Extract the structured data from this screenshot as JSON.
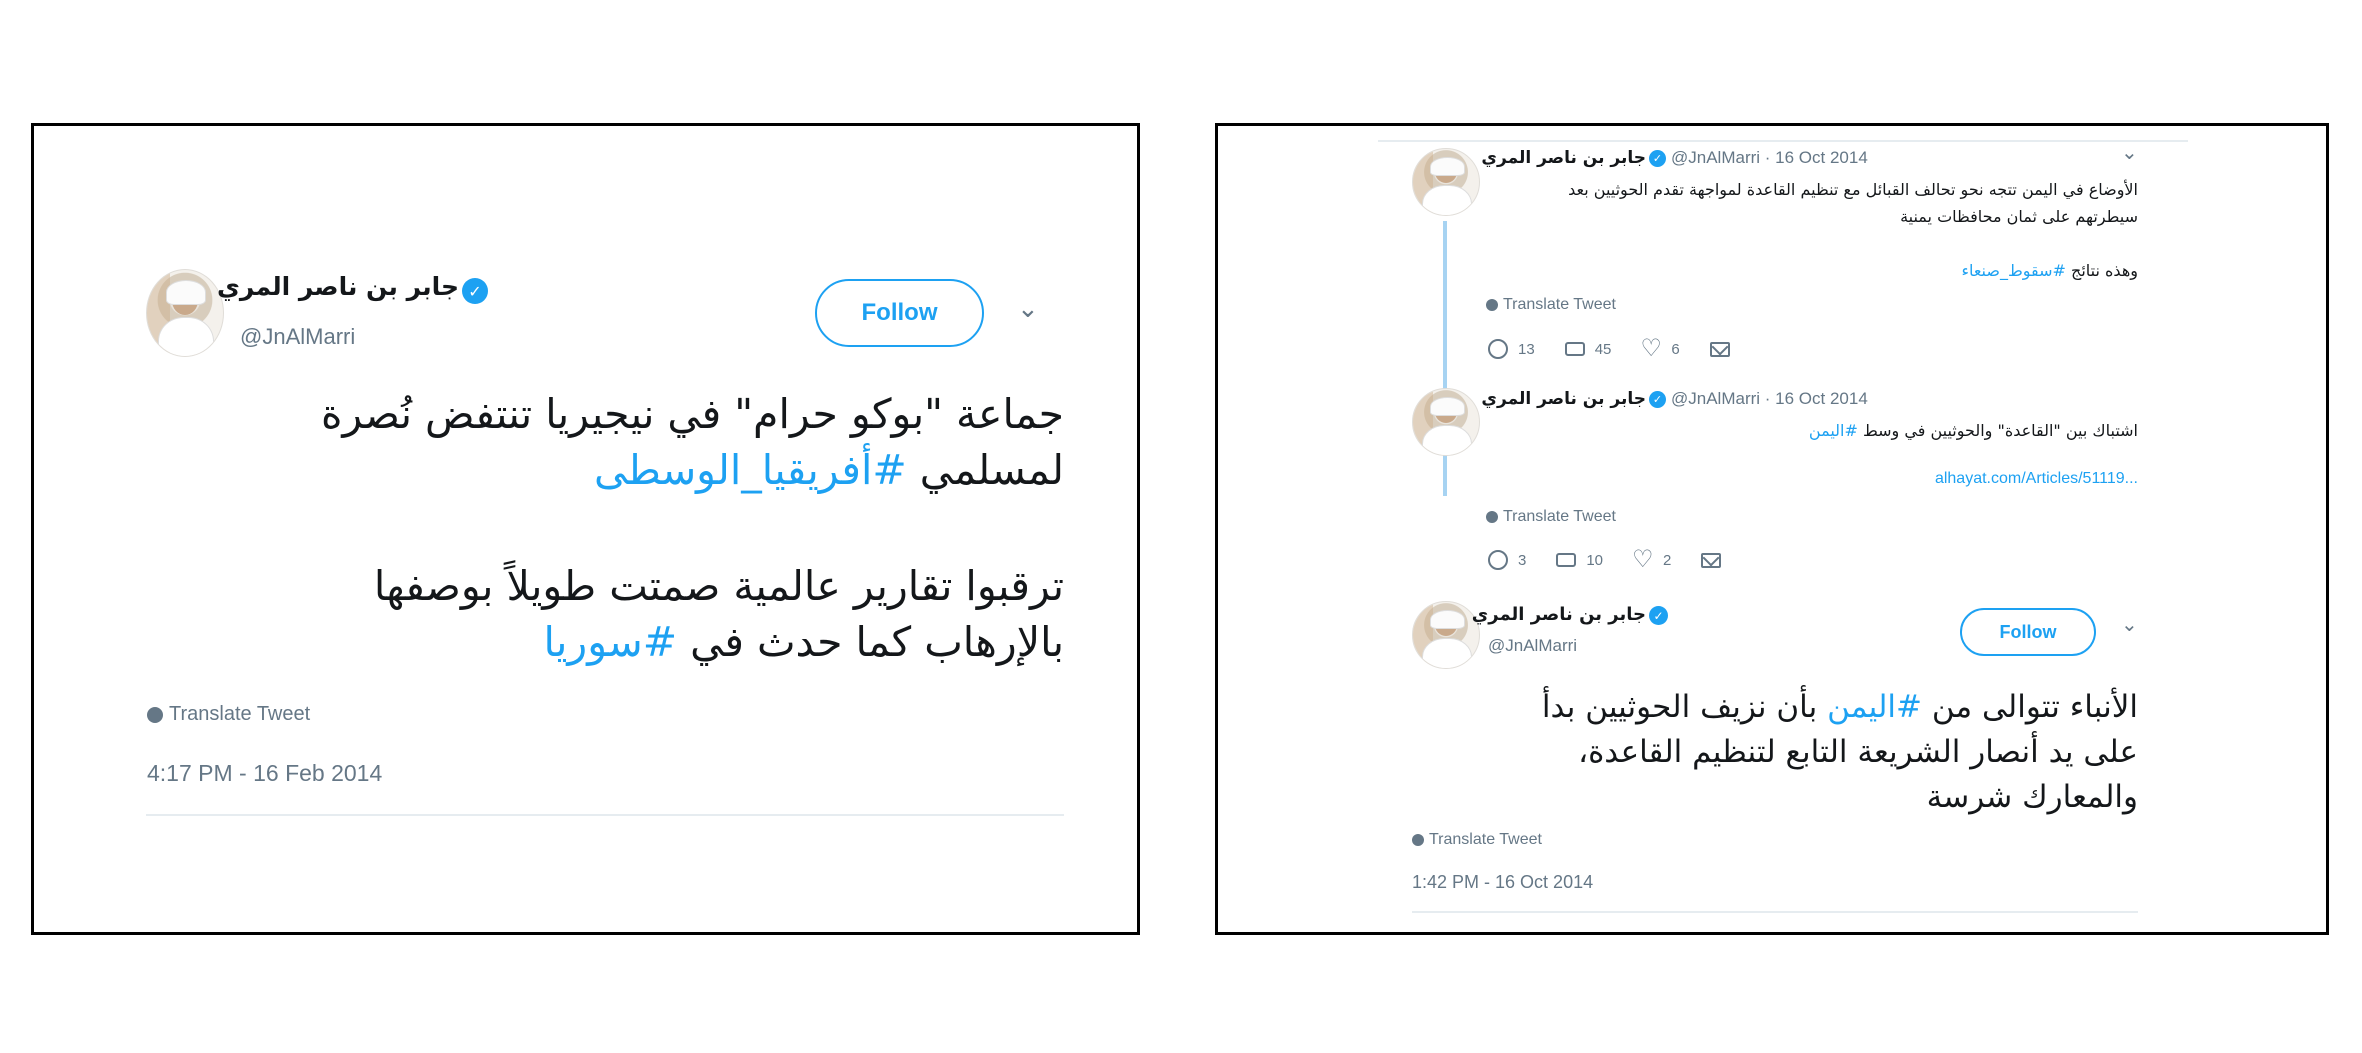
{
  "left_tweet": {
    "author_name": "جابر بن ناصر المري",
    "handle": "@JnAlMarri",
    "follow_label": "Follow",
    "text_line1": "جماعة \"بوكو حرام\" في نيجيريا تنتفض نُصرة",
    "text_line2_prefix": "لمسلمي ",
    "text_line2_tag": "#أفريقيا_الوسطى",
    "text_line3": "ترقبوا تقارير عالمية صمتت طويلاً بوصفها",
    "text_line4_prefix": "بالإرهاب كما حدث في ",
    "text_line4_tag": "#سوريا",
    "translate_label": "Translate Tweet",
    "timestamp": "4:17 PM - 16 Feb 2014"
  },
  "right_thread": {
    "tweet1": {
      "author_name": "جابر بن ناصر المري",
      "handle_date": "@JnAlMarri · 16 Oct 2014",
      "text_line1": "الأوضاع في اليمن تتجه نحو تحالف القبائل مع تنظيم القاعدة لمواجهة تقدم الحوثيين بعد",
      "text_line2": "سيطرتهم على ثمان محافظات يمنية",
      "text_line3_prefix": "وهذه نتائج ",
      "text_line3_tag": "#سقوط_صنعاء",
      "translate_label": "Translate Tweet",
      "replies": "13",
      "retweets": "45",
      "likes": "6"
    },
    "tweet2": {
      "author_name": "جابر بن ناصر المري",
      "handle_date": "@JnAlMarri · 16 Oct 2014",
      "text_line1_prefix": "اشتباك بين \"القاعدة\" والحوثيين في وسط ",
      "text_line1_tag": "#اليمن",
      "link": "alhayat.com/Articles/51119...",
      "translate_label": "Translate Tweet",
      "replies": "3",
      "retweets": "10",
      "likes": "2"
    },
    "tweet3": {
      "author_name": "جابر بن ناصر المري",
      "handle": "@JnAlMarri",
      "follow_label": "Follow",
      "text_line1_prefix": "الأنباء تتوالى من ",
      "text_line1_tag": "#اليمن",
      "text_line1_suffix": " بأن نزيف الحوثيين بدأ",
      "text_line2": "على يد أنصار الشريعة التابع لتنظيم القاعدة،",
      "text_line3": "والمعارك شرسة",
      "translate_label": "Translate Tweet",
      "timestamp": "1:42 PM - 16 Oct 2014"
    }
  },
  "icons": {
    "verified": "verified-badge-icon",
    "chevron": "chevron-down-icon",
    "globe": "globe-icon"
  },
  "colors": {
    "twitter_blue": "#1da1f2",
    "muted_gray": "#657786",
    "text": "#14171a"
  }
}
